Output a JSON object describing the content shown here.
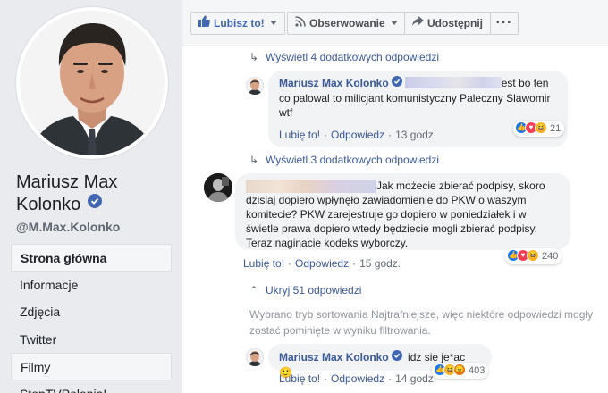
{
  "page": {
    "name_line1": "Mariusz Max",
    "name_line2": "Kolonko",
    "handle": "@M.Max.Kolonko"
  },
  "nav": {
    "items": [
      {
        "label": "Strona główna"
      },
      {
        "label": "Informacje"
      },
      {
        "label": "Zdjęcia"
      },
      {
        "label": "Twitter"
      },
      {
        "label": "Filmy"
      },
      {
        "label": "StopTVPolonia!"
      }
    ]
  },
  "toolbar": {
    "like_label": "Lubisz to!",
    "follow_label": "Obserwowanie",
    "share_label": "Udostępnij",
    "more_label": "···"
  },
  "thread": {
    "view_more_1": "Wyświetl 4 dodatkowych odpowiedzi",
    "reply1": {
      "author": "Mariusz Max Kolonko",
      "text_after_blur": "est bo",
      "text_rest": "ten co palowal to milicjant komunistyczny Paleczny Slawomir wtf",
      "like_action": "Lubię to!",
      "reply_action": "Odpowiedz",
      "time": "13 godz.",
      "reaction_count": "21"
    },
    "view_more_2": "Wyświetl 3 dodatkowych odpowiedzi",
    "comment2": {
      "text": "Jak możecie zbierać podpisy, skoro dzisiaj dopiero wpłynęło zawiadomienie do PKW o waszym komitecie? PKW zarejestruje go dopiero w poniedziałek i w świetle prawa dopiero wtedy będziecie mogli zbierać podpisy. Teraz naginacie kodeks wyborczy.",
      "like_action": "Lubię to!",
      "reply_action": "Odpowiedz",
      "time": "15 godz.",
      "reaction_count": "240"
    },
    "hide_replies": "Ukryj 51 odpowiedzi",
    "sort_notice": "Wybrano tryb sortowania Najtrafniejsze, więc niektóre odpowiedzi mogły zostać pominięte w wyniku filtrowania.",
    "reply3": {
      "author": "Mariusz Max Kolonko",
      "text": "idz sie je*ac",
      "emoji": "🙂",
      "like_action": "Lubię to!",
      "reply_action": "Odpowiedz",
      "time": "14 godz.",
      "reaction_count": "403"
    }
  },
  "colors": {
    "link": "#385898",
    "verified": "#4267b2",
    "bubble": "#f2f3f5",
    "background": "#e9ebee"
  }
}
